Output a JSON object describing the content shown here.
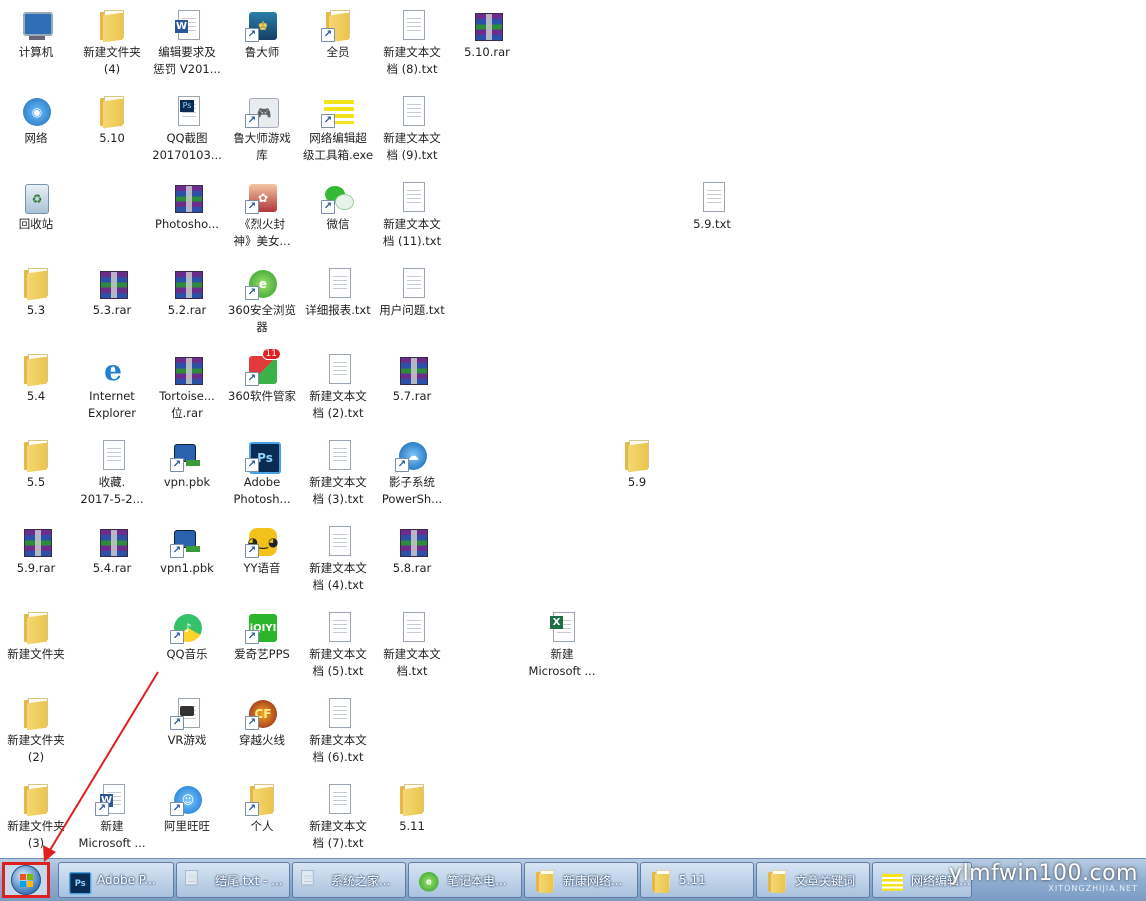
{
  "desktop": {
    "icons": [
      {
        "label": "计算机",
        "icon": "computer-icon"
      },
      {
        "label": "新建文件夹\n(4)",
        "icon": "folder-icon"
      },
      {
        "label": "编辑要求及\n惩罚 V201...",
        "icon": "word-document-icon"
      },
      {
        "label": "鲁大师",
        "icon": "ludashi-icon"
      },
      {
        "label": "全员",
        "icon": "folder-icon"
      },
      {
        "label": "新建文本文\n档 (8).txt",
        "icon": "text-file-icon"
      },
      {
        "label": "5.10.rar",
        "icon": "rar-archive-icon"
      },
      {
        "label": "网络",
        "icon": "network-icon"
      },
      {
        "label": "5.10",
        "icon": "folder-icon"
      },
      {
        "label": "QQ截图\n20170103...",
        "icon": "photoshop-file-icon"
      },
      {
        "label": "鲁大师游戏\n库",
        "icon": "gamepad-icon"
      },
      {
        "label": "网络编辑超\n级工具箱.exe",
        "icon": "toolbox-icon"
      },
      {
        "label": "新建文本文\n档 (9).txt",
        "icon": "text-file-icon"
      },
      {
        "label": "回收站",
        "icon": "recycle-bin-icon"
      },
      {
        "label": "Photosho...",
        "icon": "rar-archive-icon"
      },
      {
        "label": "《烈火封\n神》美女...",
        "icon": "game-character-icon"
      },
      {
        "label": "微信",
        "icon": "wechat-icon"
      },
      {
        "label": "新建文本文\n档 (11).txt",
        "icon": "text-file-icon"
      },
      {
        "label": "5.9.txt",
        "icon": "text-file-icon"
      },
      {
        "label": "5.3",
        "icon": "folder-icon"
      },
      {
        "label": "5.3.rar",
        "icon": "rar-archive-icon"
      },
      {
        "label": "5.2.rar",
        "icon": "rar-archive-icon"
      },
      {
        "label": "360安全浏览\n器",
        "icon": "360-browser-icon"
      },
      {
        "label": "详细报表.txt",
        "icon": "text-file-icon"
      },
      {
        "label": "用户问题.txt",
        "icon": "text-file-icon"
      },
      {
        "label": "5.4",
        "icon": "folder-icon"
      },
      {
        "label": "Internet\nExplorer",
        "icon": "internet-explorer-icon"
      },
      {
        "label": "Tortoise...\n位.rar",
        "icon": "rar-archive-icon"
      },
      {
        "label": "360软件管家",
        "icon": "360-software-manager-icon",
        "badge": "11"
      },
      {
        "label": "新建文本文\n档 (2).txt",
        "icon": "text-file-icon"
      },
      {
        "label": "5.7.rar",
        "icon": "rar-archive-icon"
      },
      {
        "label": "5.5",
        "icon": "folder-icon"
      },
      {
        "label": "收藏.\n2017-5-2...",
        "icon": "blank-file-icon"
      },
      {
        "label": "vpn.pbk",
        "icon": "network-connection-icon"
      },
      {
        "label": "Adobe\nPhotosh...",
        "icon": "photoshop-icon"
      },
      {
        "label": "新建文本文\n档 (3).txt",
        "icon": "text-file-icon"
      },
      {
        "label": "影子系统\nPowerSh...",
        "icon": "shadow-system-icon"
      },
      {
        "label": "5.9",
        "icon": "folder-icon"
      },
      {
        "label": "5.9.rar",
        "icon": "rar-archive-icon"
      },
      {
        "label": "5.4.rar",
        "icon": "rar-archive-icon"
      },
      {
        "label": "vpn1.pbk",
        "icon": "network-connection-icon"
      },
      {
        "label": "YY语音",
        "icon": "yy-voice-icon"
      },
      {
        "label": "新建文本文\n档 (4).txt",
        "icon": "text-file-icon"
      },
      {
        "label": "5.8.rar",
        "icon": "rar-archive-icon"
      },
      {
        "label": "新建文件夹",
        "icon": "folder-icon"
      },
      {
        "label": "QQ音乐",
        "icon": "qq-music-icon"
      },
      {
        "label": "爱奇艺PPS",
        "icon": "iqiyi-icon"
      },
      {
        "label": "新建文本文\n档 (5).txt",
        "icon": "text-file-icon"
      },
      {
        "label": "新建文本文\n档.txt",
        "icon": "text-file-icon"
      },
      {
        "label": "新建\nMicrosoft ...",
        "icon": "excel-document-icon"
      },
      {
        "label": "新建文件夹\n(2)",
        "icon": "folder-icon"
      },
      {
        "label": "VR游戏",
        "icon": "vr-game-icon"
      },
      {
        "label": "穿越火线",
        "icon": "crossfire-icon"
      },
      {
        "label": "新建文本文\n档 (6).txt",
        "icon": "text-file-icon"
      },
      {
        "label": "新建文件夹\n(3)",
        "icon": "folder-icon"
      },
      {
        "label": "新建\nMicrosoft ...",
        "icon": "word-document-icon"
      },
      {
        "label": "阿里旺旺",
        "icon": "aliwangwang-icon"
      },
      {
        "label": "个人",
        "icon": "folder-icon"
      },
      {
        "label": "新建文本文\n档 (7).txt",
        "icon": "text-file-icon"
      },
      {
        "label": "5.11",
        "icon": "folder-icon"
      }
    ]
  },
  "taskbar": {
    "start": {
      "icon": "windows-start-orb-icon"
    },
    "buttons": [
      {
        "label": "Adobe P...",
        "icon": "photoshop-icon"
      },
      {
        "label": "结尾.txt - ...",
        "icon": "notepad-icon"
      },
      {
        "label": "系统之家...",
        "icon": "notepad-icon"
      },
      {
        "label": "笔记本电...",
        "icon": "360-browser-icon"
      },
      {
        "label": "新康网络...",
        "icon": "folder-icon"
      },
      {
        "label": "5.11",
        "icon": "folder-icon"
      },
      {
        "label": "文章关键词",
        "icon": "folder-icon"
      },
      {
        "label": "网络编辑...",
        "icon": "toolbox-icon"
      }
    ],
    "watermark": {
      "main": "ylmfwin100.com",
      "sub": "XITONGZHIJIA.NET"
    }
  },
  "colors": {
    "taskbar": "#8eadd0",
    "start_highlight": "#e01f1f",
    "annotation_arrow": "#e01f1f"
  }
}
